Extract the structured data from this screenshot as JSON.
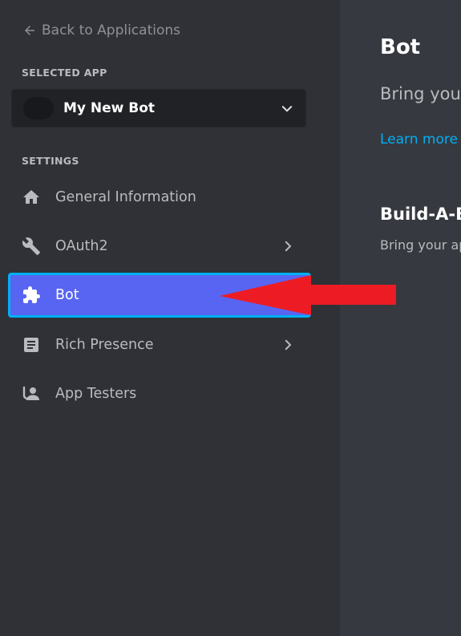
{
  "sidebar": {
    "back_label": "Back to Applications",
    "selected_app_heading": "SELECTED APP",
    "selected_app_name": "My New Bot",
    "settings_heading": "SETTINGS",
    "items": [
      {
        "label": "General Information",
        "icon": "home-icon",
        "has_chevron": false
      },
      {
        "label": "OAuth2",
        "icon": "wrench-icon",
        "has_chevron": true
      },
      {
        "label": "Bot",
        "icon": "puzzle-icon",
        "has_chevron": false,
        "active": true
      },
      {
        "label": "Rich Presence",
        "icon": "document-icon",
        "has_chevron": true
      },
      {
        "label": "App Testers",
        "icon": "person-icon",
        "has_chevron": false
      }
    ]
  },
  "main": {
    "title": "Bot",
    "subtitle": "Bring your",
    "learn_more": "Learn more a",
    "section_title": "Build-A-Bo",
    "section_desc": "Bring your ap"
  },
  "colors": {
    "sidebar_bg": "#2f3136",
    "main_bg": "#36393f",
    "active_bg": "#5865f2",
    "active_border": "#00b0f4",
    "link": "#00aff4",
    "annotation_arrow": "#ed1c24"
  }
}
